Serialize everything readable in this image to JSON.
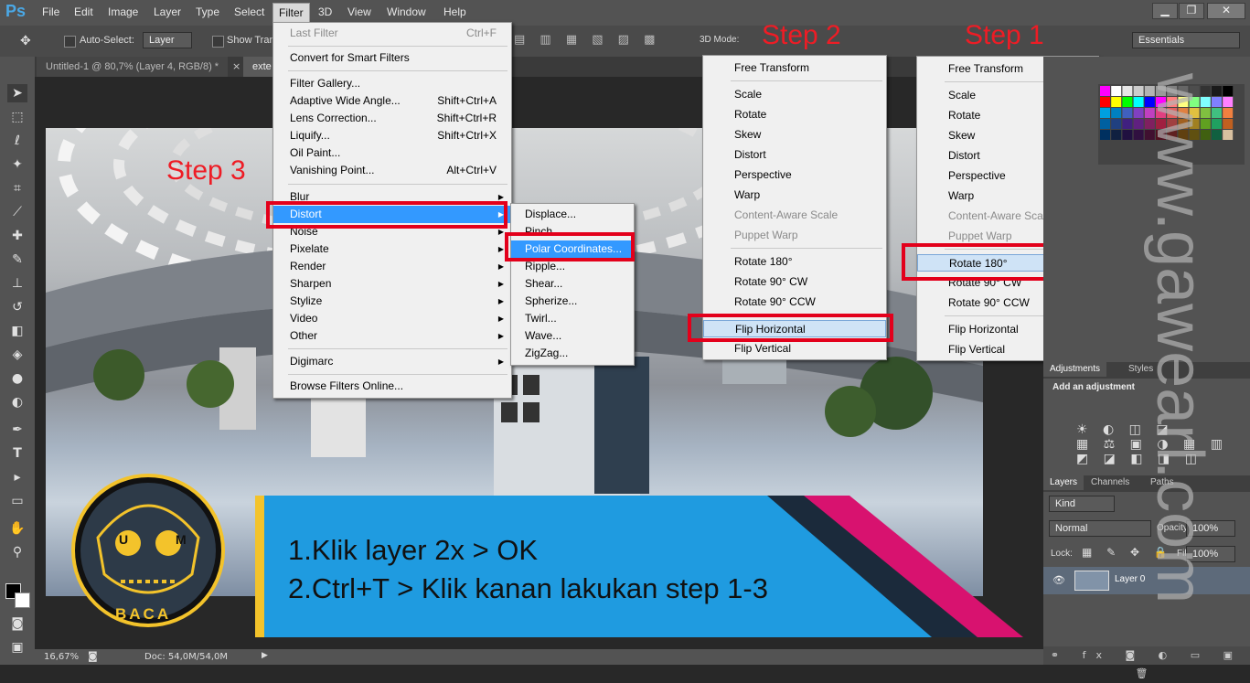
{
  "app": {
    "logo": "Ps"
  },
  "menubar": {
    "items": [
      "File",
      "Edit",
      "Image",
      "Layer",
      "Type",
      "Select",
      "Filter",
      "3D",
      "View",
      "Window",
      "Help"
    ],
    "active": "Filter"
  },
  "window_buttons": [
    "▁",
    "❐",
    "✕"
  ],
  "options": {
    "auto_select_label": "Auto-Select:",
    "auto_select_value": "Layer",
    "show_transform_label": "Show Trans",
    "mode_3d_label": "3D Mode:",
    "workspace": "Essentials"
  },
  "tabs": [
    "Untitled-1 @ 80,7% (Layer 4, RGB/8) *",
    "exte"
  ],
  "filter_menu": {
    "last_filter": "Last Filter",
    "last_filter_sc": "Ctrl+F",
    "convert_smart": "Convert for Smart Filters",
    "gallery": "Filter Gallery...",
    "adaptive": "Adaptive Wide Angle...",
    "adaptive_sc": "Shift+Ctrl+A",
    "lens": "Lens Correction...",
    "lens_sc": "Shift+Ctrl+R",
    "liquify": "Liquify...",
    "liquify_sc": "Shift+Ctrl+X",
    "oil": "Oil Paint...",
    "vanishing": "Vanishing Point...",
    "vanishing_sc": "Alt+Ctrl+V",
    "blur": "Blur",
    "distort": "Distort",
    "noise": "Noise",
    "pixelate": "Pixelate",
    "render": "Render",
    "sharpen": "Sharpen",
    "stylize": "Stylize",
    "video": "Video",
    "other": "Other",
    "digimarc": "Digimarc",
    "browse": "Browse Filters Online..."
  },
  "distort_menu": [
    "Displace...",
    "Pinch...",
    "Polar Coordinates...",
    "Ripple...",
    "Shear...",
    "Spherize...",
    "Twirl...",
    "Wave...",
    "ZigZag..."
  ],
  "transform_menu": {
    "free": "Free Transform",
    "scale": "Scale",
    "rotate": "Rotate",
    "skew": "Skew",
    "distort": "Distort",
    "perspective": "Perspective",
    "warp": "Warp",
    "content_aware": "Content-Aware Scale",
    "puppet": "Puppet Warp",
    "rot180": "Rotate 180°",
    "rot90cw": "Rotate 90° CW",
    "rot90ccw": "Rotate 90° CCW",
    "fliph": "Flip Horizontal",
    "flipv": "Flip Vertical"
  },
  "steps": {
    "s1": "Step 1",
    "s2": "Step 2",
    "s3": "Step 3"
  },
  "banner": {
    "line1": "1.Klik layer 2x > OK",
    "line2": "2.Ctrl+T > Klik kanan lakukan step 1-3"
  },
  "logo_badge": {
    "letters": "U M",
    "word": "BACA"
  },
  "watermark": "www.gawearl.com",
  "panels": {
    "adjust_tabs": [
      "Adjustments",
      "Styles"
    ],
    "add_adjustment": "Add an adjustment",
    "layer_tabs": [
      "Layers",
      "Channels",
      "Paths"
    ],
    "kind": "Kind",
    "blend": "Normal",
    "opacity_label": "Opacity:",
    "opacity": "100%",
    "lock_label": "Lock:",
    "fill_label": "Fill:",
    "fill": "100%",
    "layer_name": "Layer 0"
  },
  "status": {
    "zoom": "16,67%",
    "doc": "Doc: 54,0M/54,0M"
  },
  "colors": {
    "accent": "#3399ff",
    "red": "#e3001b",
    "banner_blue": "#1f9be0",
    "banner_pink": "#d8126f",
    "banner_yellow": "#f3c32b"
  }
}
